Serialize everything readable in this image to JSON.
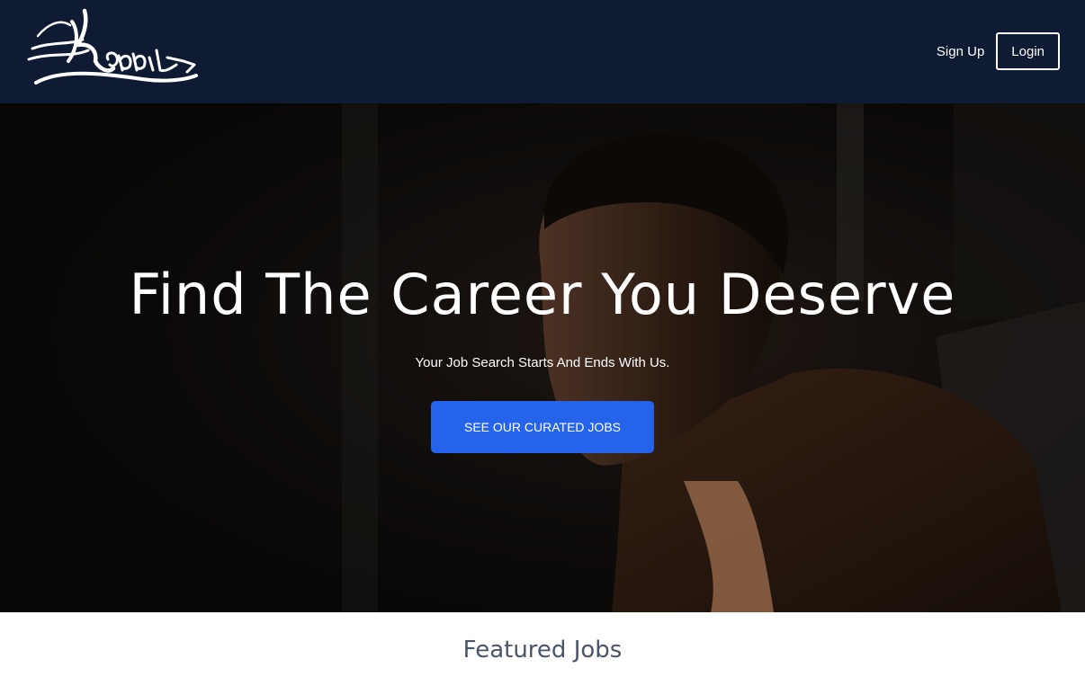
{
  "brand": {
    "name": "Rabbit",
    "nav_bg": "#0f1a33",
    "accent": "#2563eb"
  },
  "nav": {
    "signup_label": "Sign Up",
    "login_label": "Login"
  },
  "hero": {
    "title": "Find The Career You Deserve",
    "subtitle": "Your Job Search Starts And Ends With Us.",
    "cta_label": "SEE OUR CURATED JOBS"
  },
  "featured": {
    "title": "Featured Jobs"
  }
}
